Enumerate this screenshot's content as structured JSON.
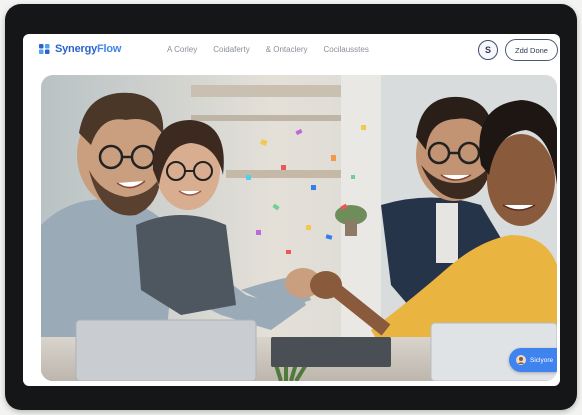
{
  "app": {
    "brand": {
      "name_main": "Synergy",
      "name_accent": "Flow"
    },
    "nav": {
      "items": [
        {
          "label": "A Corley"
        },
        {
          "label": "Coidaferty"
        },
        {
          "label": "& Ontaclery"
        },
        {
          "label": "Cocilausstes"
        }
      ],
      "account_initial": "S",
      "primary_button_label": "Zdd Done"
    },
    "hero": {
      "image_description_icon": "team-fistbump-photo",
      "cta_label": "Siclyore"
    },
    "colors": {
      "brand": "#2d63c9",
      "accent": "#3f83ee",
      "device_frame": "#151617"
    }
  }
}
